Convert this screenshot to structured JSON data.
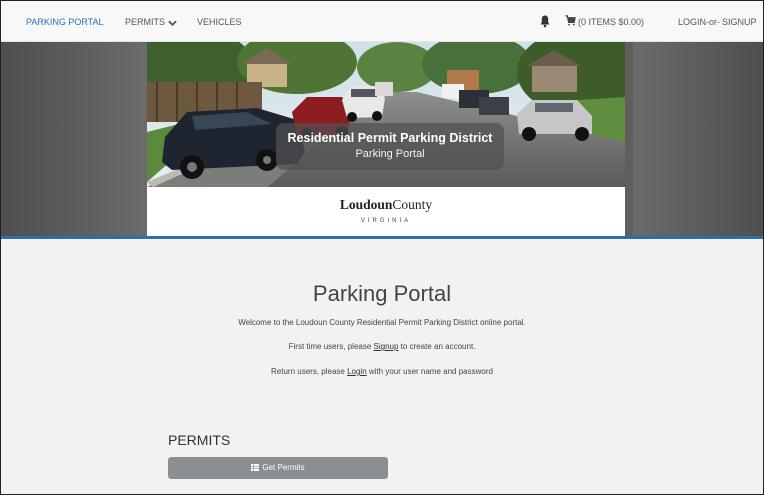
{
  "nav": {
    "brand": "PARKING PORTAL",
    "permits": "PERMITS",
    "vehicles": "VEHICLES",
    "cart": "(0 ITEMS $0.00)",
    "login": "LOGIN",
    "or": "-or-",
    "signup": "SIGNUP"
  },
  "banner": {
    "title": "Residential Permit Parking District",
    "subtitle": "Parking Portal",
    "logo_word1": "Loudoun",
    "logo_word2": "County",
    "logo_state": "VIRGINIA"
  },
  "main": {
    "heading": "Parking Portal",
    "welcome": "Welcome to the Loudoun County Residential Permit Parking District online portal.",
    "first_pre": "First time users, please ",
    "first_link": "Signup",
    "first_post": " to create an account.",
    "return_pre": "Return users, please ",
    "return_link": "Login",
    "return_post": " with your user name and password"
  },
  "permits": {
    "heading": "PERMITS",
    "button": "Get Permits"
  },
  "colors": {
    "accent": "#2a72b5",
    "button": "#8a8f94",
    "rule": "#2a6fb0"
  },
  "icons": [
    "chevron-down-icon",
    "bell-icon",
    "cart-icon",
    "table-icon"
  ]
}
